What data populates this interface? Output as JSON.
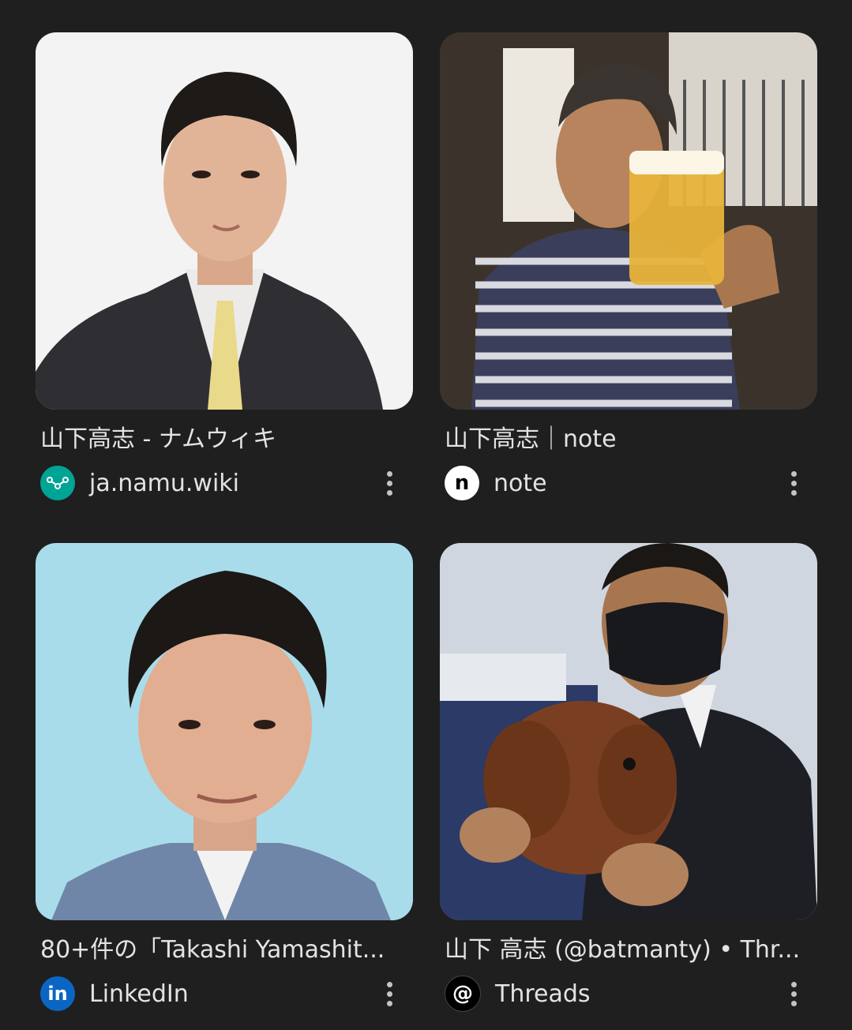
{
  "results": [
    {
      "title": "山下高志 - ナムウィキ",
      "source": "ja.namu.wiki",
      "favicon": "namu-wiki-icon",
      "favicon_color": "#00a495"
    },
    {
      "title": "山下高志｜note",
      "source": "note",
      "favicon": "note-icon",
      "favicon_color": "#ffffff"
    },
    {
      "title": "80+件の「Takashi Yamashit...",
      "source": "LinkedIn",
      "favicon": "linkedin-icon",
      "favicon_color": "#0a66c2"
    },
    {
      "title": "山下 高志 (@batmanty) • Thr...",
      "source": "Threads",
      "favicon": "threads-icon",
      "favicon_color": "#000000"
    }
  ]
}
